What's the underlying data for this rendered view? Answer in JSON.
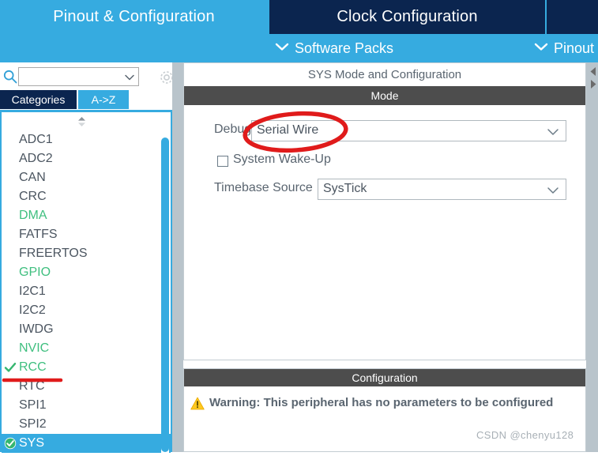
{
  "tabs": [
    {
      "label": "Pinout & Configuration",
      "active": true
    },
    {
      "label": "Clock Configuration",
      "active": false
    },
    {
      "label": "",
      "active": false
    }
  ],
  "submenu": [
    {
      "label": "Software Packs",
      "icon": "chevron-down-icon"
    },
    {
      "label": "Pinout",
      "icon": "chevron-down-icon"
    }
  ],
  "sidebar": {
    "search": {
      "value": "",
      "placeholder": "",
      "icon": "search-icon"
    },
    "gear_icon": "gear-icon",
    "category_tabs": [
      {
        "label": "Categories",
        "active": false
      },
      {
        "label": "A->Z",
        "active": true
      }
    ],
    "sort_icon": "sort-updown-icon",
    "peripherals": [
      {
        "label": "ADC1",
        "state": "normal"
      },
      {
        "label": "ADC2",
        "state": "normal"
      },
      {
        "label": "CAN",
        "state": "normal"
      },
      {
        "label": "CRC",
        "state": "normal"
      },
      {
        "label": "DMA",
        "state": "configured"
      },
      {
        "label": "FATFS",
        "state": "normal"
      },
      {
        "label": "FREERTOS",
        "state": "normal"
      },
      {
        "label": "GPIO",
        "state": "configured"
      },
      {
        "label": "I2C1",
        "state": "normal"
      },
      {
        "label": "I2C2",
        "state": "normal"
      },
      {
        "label": "IWDG",
        "state": "normal"
      },
      {
        "label": "NVIC",
        "state": "configured"
      },
      {
        "label": "RCC",
        "state": "configured-check"
      },
      {
        "label": "RTC",
        "state": "normal"
      },
      {
        "label": "SPI1",
        "state": "normal"
      },
      {
        "label": "SPI2",
        "state": "normal"
      },
      {
        "label": "SYS",
        "state": "selected-check"
      }
    ]
  },
  "main": {
    "panel_title": "SYS Mode and Configuration",
    "mode_header": "Mode",
    "debug": {
      "label": "Debug",
      "value": "Serial Wire",
      "arrow_icon": "chevron-down-icon"
    },
    "system_wakeup": {
      "label": "System Wake-Up",
      "checked": false
    },
    "timebase": {
      "label": "Timebase Source",
      "value": "SysTick",
      "arrow_icon": "chevron-down-icon"
    },
    "config_header": "Configuration",
    "warning": {
      "icon": "warning-triangle-icon",
      "text": "Warning: This peripheral has no parameters to be configured"
    },
    "watermark": "CSDN @chenyu128"
  },
  "colors": {
    "accent_blue": "#36abe0",
    "tab_navy": "#0b254f",
    "header_gray": "#4d4d4d",
    "configured_green": "#3fbf7f",
    "text_gray": "#4b5560",
    "annotation_red": "#e01b1b",
    "warning_yellow": "#ffc81e"
  },
  "annotations": [
    {
      "type": "ellipse",
      "target": "debug-value-serial-wire",
      "color": "#e01b1b"
    },
    {
      "type": "underline",
      "target": "sidebar-item-rcc",
      "color": "#e01b1b"
    }
  ]
}
